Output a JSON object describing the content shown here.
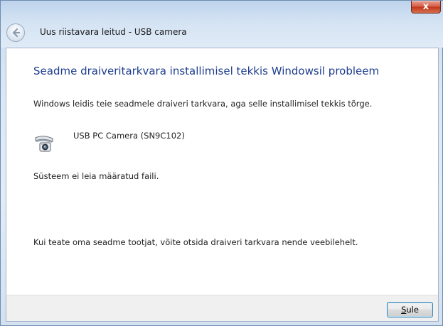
{
  "window": {
    "close_glyph": "x",
    "nav_title": "Uus riistavara leitud - USB camera"
  },
  "main": {
    "heading": "Seadme draiveritarkvara installimisel tekkis Windowsil probleem",
    "found_text": "Windows leidis teie seadmele draiveri tarkvara, aga selle installimisel tekkis tõrge.",
    "device_name": "USB PC Camera (SN9C102)",
    "error_text": "Süsteem ei leia määratud faili.",
    "hint_text": "Kui teate oma seadme tootjat, võite otsida draiveri tarkvara nende veebilehelt."
  },
  "footer": {
    "close_button": {
      "accel": "S",
      "rest": "ule"
    }
  },
  "colors": {
    "heading": "#1e3d8f",
    "button_border": "#3c7fb1",
    "close_red": "#c2381b"
  },
  "icons": [
    "back-arrow-icon",
    "close-icon",
    "usb-camera-icon"
  ]
}
